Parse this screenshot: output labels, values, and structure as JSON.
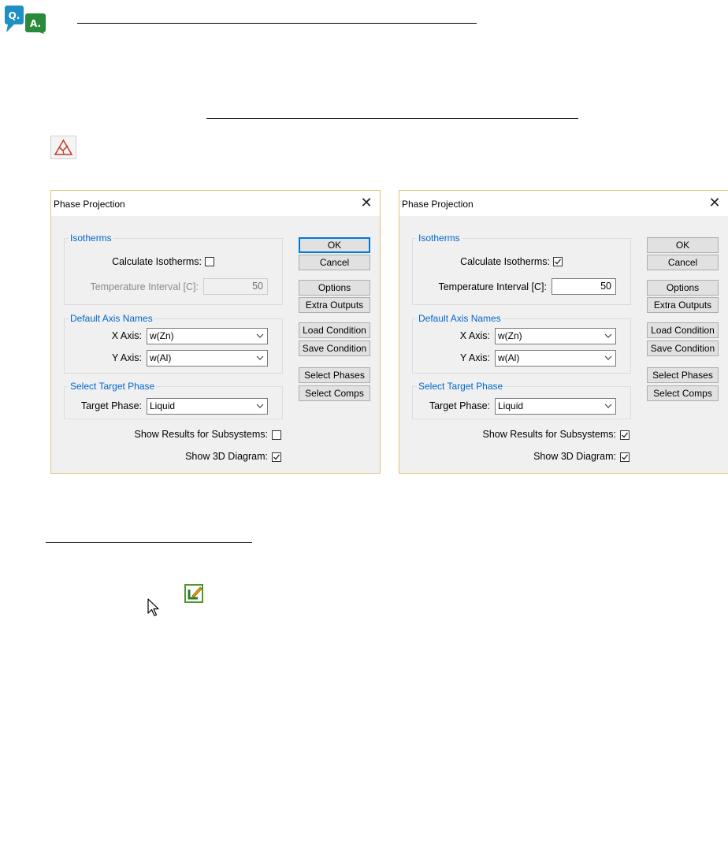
{
  "dialogs": [
    {
      "title": "Phase Projection",
      "isotherms": {
        "group_title": "Isotherms",
        "calc_label": "Calculate Isotherms:",
        "calc_checked": false,
        "temp_label": "Temperature Interval [C]:",
        "temp_value": "50",
        "temp_enabled": false
      },
      "axis": {
        "group_title": "Default Axis Names",
        "x_label": "X Axis:",
        "x_value": "w(Zn)",
        "y_label": "Y Axis:",
        "y_value": "w(Al)"
      },
      "target": {
        "group_title": "Select Target Phase",
        "label": "Target Phase:",
        "value": "Liquid"
      },
      "subsystems": {
        "label": "Show Results for Subsystems:",
        "checked": false
      },
      "diagram3d": {
        "label": "Show 3D Diagram:",
        "checked": true
      },
      "buttons": {
        "ok": "OK",
        "cancel": "Cancel",
        "options": "Options",
        "extra_outputs": "Extra Outputs",
        "load_condition": "Load Condition",
        "save_condition": "Save Condition",
        "select_phases": "Select Phases",
        "select_comps": "Select Comps"
      }
    },
    {
      "title": "Phase Projection",
      "isotherms": {
        "group_title": "Isotherms",
        "calc_label": "Calculate Isotherms:",
        "calc_checked": true,
        "temp_label": "Temperature Interval [C]:",
        "temp_value": "50",
        "temp_enabled": true
      },
      "axis": {
        "group_title": "Default Axis Names",
        "x_label": "X Axis:",
        "x_value": "w(Zn)",
        "y_label": "Y Axis:",
        "y_value": "w(Al)"
      },
      "target": {
        "group_title": "Select Target Phase",
        "label": "Target Phase:",
        "value": "Liquid"
      },
      "subsystems": {
        "label": "Show Results for Subsystems:",
        "checked": true
      },
      "diagram3d": {
        "label": "Show 3D Diagram:",
        "checked": true
      },
      "buttons": {
        "ok": "OK",
        "cancel": "Cancel",
        "options": "Options",
        "extra_outputs": "Extra Outputs",
        "load_condition": "Load Condition",
        "save_condition": "Save Condition",
        "select_phases": "Select Phases",
        "select_comps": "Select Comps"
      }
    }
  ],
  "icons": {
    "qa_badge": "qa-icon",
    "qa_letters": [
      "Q.",
      "A."
    ],
    "projection": "phase-projection-icon",
    "edit": "edit-icon",
    "cursor": "cursor-icon"
  },
  "colors": {
    "group_title": "#0066cc",
    "default_button_border": "#0078d7",
    "dialog_border": "#e3c27a",
    "qa_q": "#1f8fc4",
    "qa_a": "#2a8a3c"
  }
}
